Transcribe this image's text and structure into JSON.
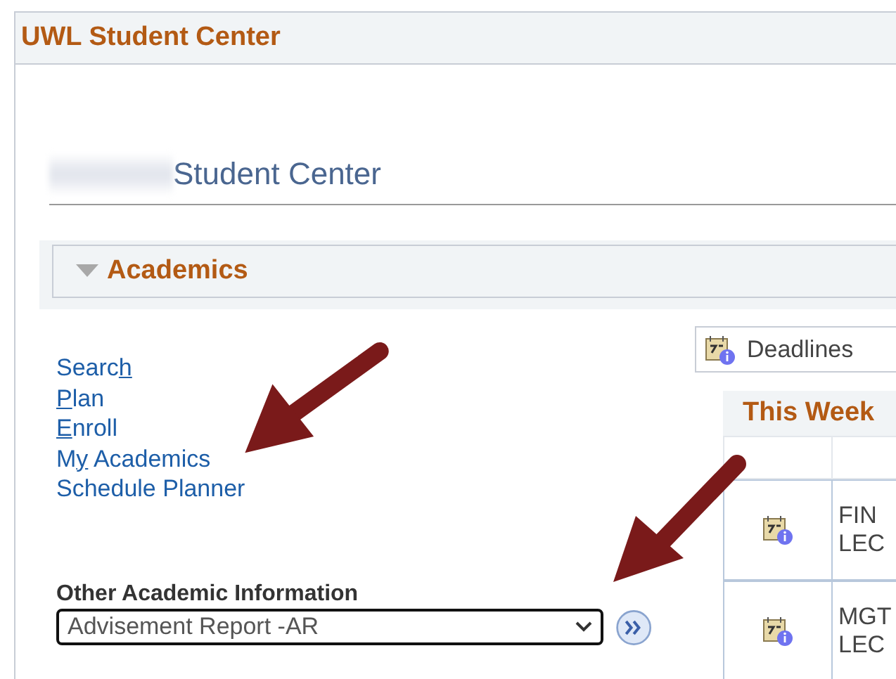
{
  "page_title": "UWL Student Center",
  "heading": {
    "name_redacted": true,
    "title": "Student Center"
  },
  "section": {
    "title": "Academics",
    "expanded": true
  },
  "links": [
    {
      "before": "Searc",
      "key": "h"
    },
    {
      "key": "P",
      "after": "lan"
    },
    {
      "key": "E",
      "after": "nroll"
    },
    {
      "before": "M",
      "key": "y",
      "after": " Academics"
    },
    {
      "before": "Schedule Planner"
    }
  ],
  "other_info": {
    "label": "Other Academic Information",
    "value": "Advisement Report -AR"
  },
  "deadlines_button": "Deadlines",
  "this_week": {
    "title": "This Week",
    "rows": [
      {
        "line_1": "FIN",
        "line_2": "LEC"
      },
      {
        "line_1": "MGT",
        "line_2": "LEC"
      }
    ]
  }
}
